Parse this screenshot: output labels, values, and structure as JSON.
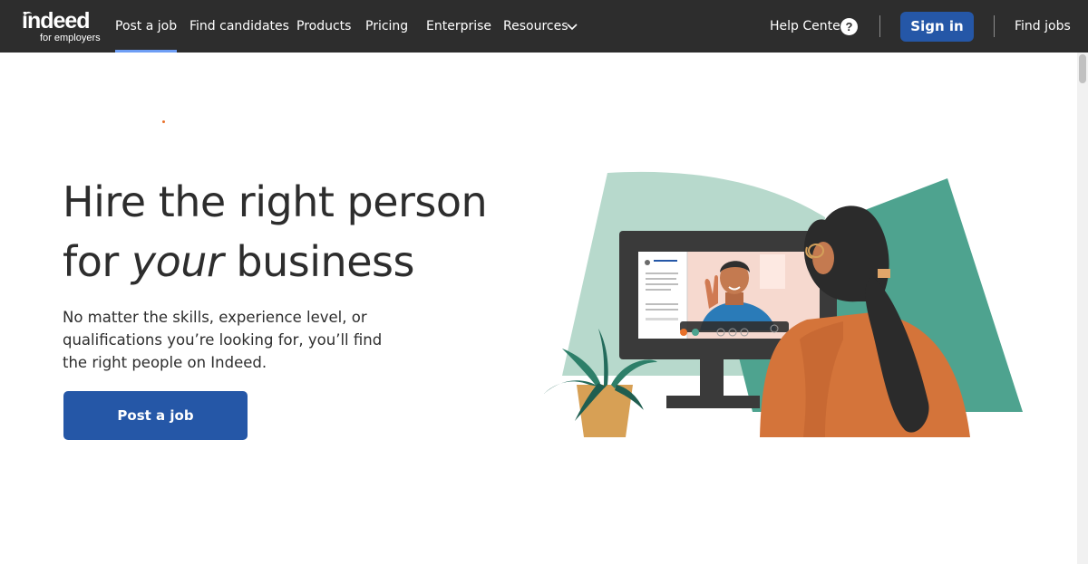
{
  "brand": {
    "wordmark": "indeed",
    "subline": "for employers"
  },
  "nav": {
    "items": [
      {
        "label": "Post a job",
        "active": true
      },
      {
        "label": "Find candidates"
      },
      {
        "label": "Products"
      },
      {
        "label": "Pricing"
      },
      {
        "label": "Enterprise"
      },
      {
        "label": "Resources"
      }
    ],
    "help_label": "Help Center",
    "help_icon": "?",
    "signin_label": "Sign in",
    "find_jobs_label": "Find jobs"
  },
  "hero": {
    "headline_before": "Hire the right person for ",
    "headline_emphasis": "your",
    "headline_after": " business",
    "subtext": "No matter the skills, experience level, or qualifications you’re looking for, you’ll find the right people on Indeed.",
    "cta_label": "Post a job"
  },
  "colors": {
    "nav_bg": "#2d2d2d",
    "brand_blue": "#2557a7",
    "active_underline": "#6e9ef5",
    "accent_orange": "#e8702a"
  }
}
